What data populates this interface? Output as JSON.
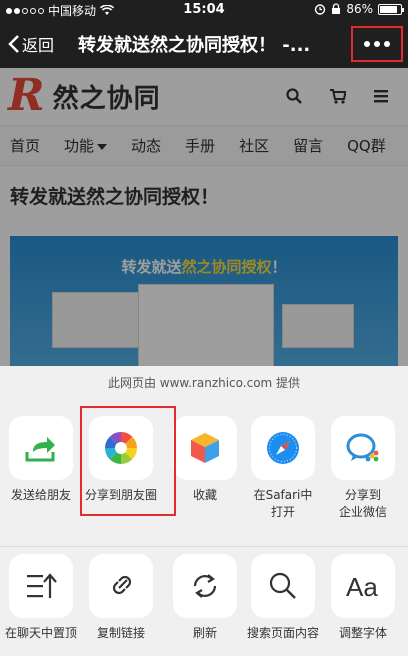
{
  "status_bar": {
    "carrier": "中国移动",
    "time": "15:04",
    "battery": "86%",
    "battery_level": 0.86
  },
  "nav": {
    "back_label": "返回",
    "title": "转发就送然之协同授权！ -..."
  },
  "site": {
    "logo_letter": "R",
    "logo_name": "然之协同",
    "menu": [
      "首页",
      "功能",
      "动态",
      "手册",
      "社区",
      "留言",
      "QQ群"
    ],
    "article_title": "转发就送然之协同授权！",
    "banner_text_a": "转发就送",
    "banner_text_b": "然之协同授权",
    "banner_text_c": "！"
  },
  "sheet": {
    "provider": "此网页由 www.ranzhico.com 提供",
    "row1": [
      {
        "label": "发送给朋友",
        "icon": "share-arrow-icon"
      },
      {
        "label": "分享到朋友圈",
        "icon": "moments-icon"
      },
      {
        "label": "收藏",
        "icon": "favorite-cube-icon"
      },
      {
        "label": "在Safari中\n打开",
        "icon": "safari-icon"
      },
      {
        "label": "分享到\n企业微信",
        "icon": "wechat-work-icon"
      }
    ],
    "row2": [
      {
        "label": "在聊天中置顶",
        "icon": "pin-top-icon"
      },
      {
        "label": "复制链接",
        "icon": "link-icon"
      },
      {
        "label": "刷新",
        "icon": "refresh-icon"
      },
      {
        "label": "搜索页面内容",
        "icon": "search-icon"
      },
      {
        "label": "调整字体",
        "icon": "font-size-icon"
      }
    ]
  },
  "colors": {
    "highlight": "#e52b2b",
    "accent_green": "#2fb24b",
    "safari_blue": "#1c8ef0"
  }
}
